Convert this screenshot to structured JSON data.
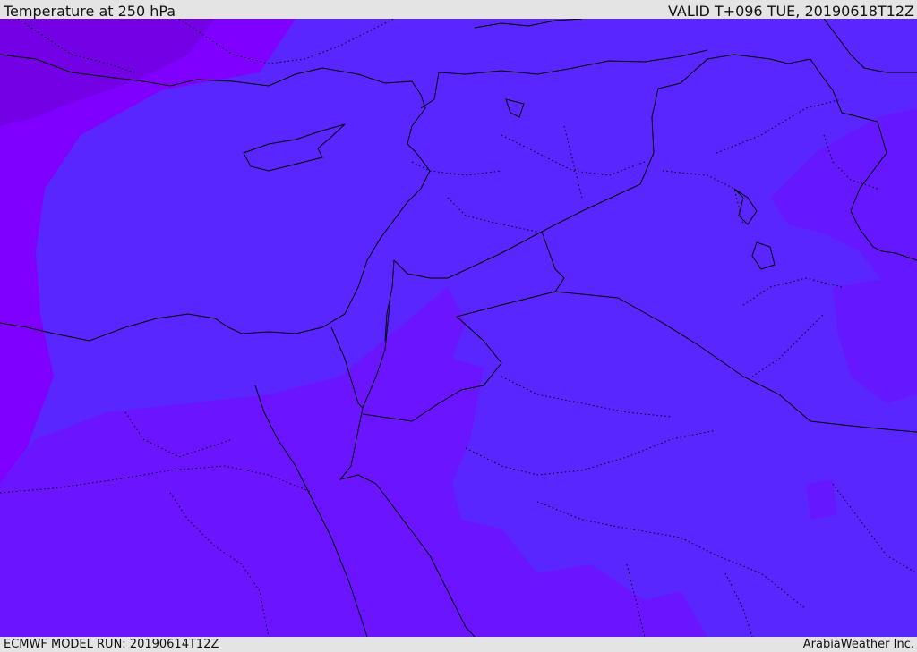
{
  "header": {
    "title": "Temperature at 250 hPa",
    "valid_time": "VALID T+096 TUE, 20190618T12Z"
  },
  "footer": {
    "model_run": "ECMWF MODEL RUN: 20190614T12Z",
    "credit": "ArabiaWeather Inc."
  },
  "colors": {
    "violet_far_west": "#8a00ff",
    "violet_mid": "#6d16ff",
    "blue_violet_main": "#5a26ff",
    "deep_violet_northwest": "#7a00e8",
    "border_line": "#000000"
  },
  "map": {
    "field": "temperature",
    "level": "250 hPa",
    "region": "Eastern Mediterranean and Middle East"
  }
}
